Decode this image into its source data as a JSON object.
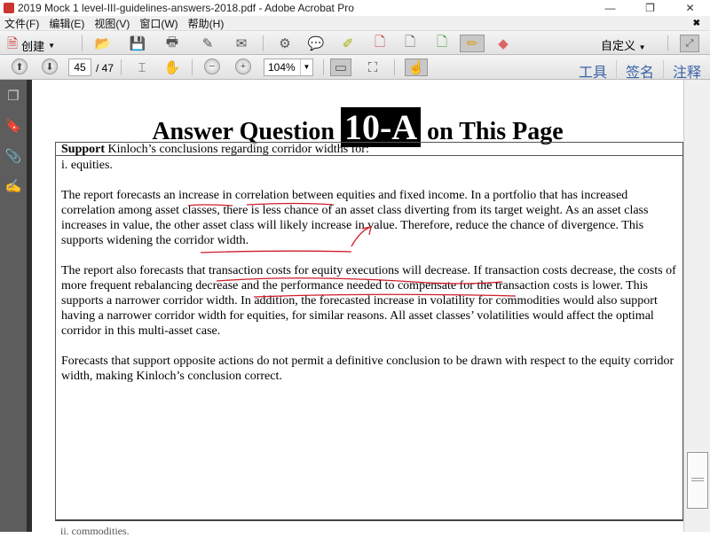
{
  "window": {
    "title": "2019 Mock 1 level-III-guidelines-answers-2018.pdf - Adobe Acrobat Pro",
    "minimize": "—",
    "restore": "❐",
    "close": "✕"
  },
  "menu": [
    "文件(F)",
    "编辑(E)",
    "视图(V)",
    "窗口(W)",
    "帮助(H)"
  ],
  "toolbar": {
    "create_label": "创建",
    "customize_label": "自定义",
    "page_current": "45",
    "page_total": "/ 47",
    "zoom": "104%"
  },
  "panels": {
    "tools": "工具",
    "sign": "签名",
    "comment": "注释"
  },
  "document": {
    "heading_pre": "Answer Question ",
    "heading_hl": "10-A",
    "heading_post": " on This Page",
    "box_head_bold": "Support",
    "box_head_rest": " Kinloch’s conclusions regarding corridor widths for:",
    "item": "i.   equities.",
    "para1": "The report forecasts an increase in correlation between equities and fixed income. In a portfolio that has increased correlation among asset classes, there is less chance of an asset class diverting from its target weight. As an asset class increases in value, the other asset class will likely increase in value. Therefore, reduce the chance of divergence. This supports widening the corridor width.",
    "para2": "The report also forecasts that transaction costs for equity executions will decrease. If transaction costs decrease, the costs of more frequent rebalancing decrease and the performance needed to compensate for the transaction costs is lower. This supports a narrower corridor width. In addition, the forecasted increase in volatility for commodities would also support having a narrower corridor width for equities, for similar reasons. All asset classes’ volatilities would affect the optimal corridor in this multi-asset case.",
    "para3": "Forecasts that support opposite actions do not permit a definitive conclusion to be drawn with respect to the equity corridor width, making Kinloch’s conclusion correct.",
    "next_item": "ii.   commodities."
  },
  "colors": {
    "ink": "#d01c2a",
    "link": "#3b62a8"
  }
}
